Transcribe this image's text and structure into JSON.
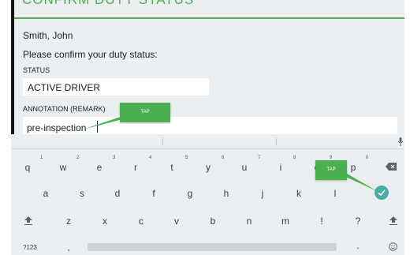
{
  "dialog": {
    "title": "CONFIRM DUTY STATUS",
    "driver_name": "Smith, John",
    "prompt": "Please confirm your duty status:",
    "status_label": "STATUS",
    "status_value": "ACTIVE DRIVER",
    "annotation_label": "ANNOTATION (REMARK)",
    "annotation_value": "pre-inspection"
  },
  "taps": {
    "tap1": "TAP",
    "tap2": "TAP"
  },
  "keyboard": {
    "row1": [
      "q",
      "w",
      "e",
      "r",
      "t",
      "y",
      "u",
      "i",
      "o",
      "p"
    ],
    "row1_hints": [
      "1",
      "2",
      "3",
      "4",
      "5",
      "6",
      "7",
      "8",
      "9",
      "0"
    ],
    "row2": [
      "a",
      "s",
      "d",
      "f",
      "g",
      "h",
      "j",
      "k",
      "l"
    ],
    "row3": [
      "z",
      "x",
      "c",
      "v",
      "b",
      "n",
      "m",
      "!",
      "?"
    ],
    "symbols_label": "?123",
    "comma": ",",
    "period": "."
  },
  "colors": {
    "accent_green": "#4caf50",
    "enter_button": "#4aaea3",
    "dark_frame": "#141414",
    "keyboard_bg": "#eceff1"
  },
  "icons": {
    "backspace": "backspace-icon",
    "shift": "shift-icon",
    "enter": "checkmark-icon",
    "mic": "microphone-icon",
    "emoji": "emoji-icon"
  }
}
